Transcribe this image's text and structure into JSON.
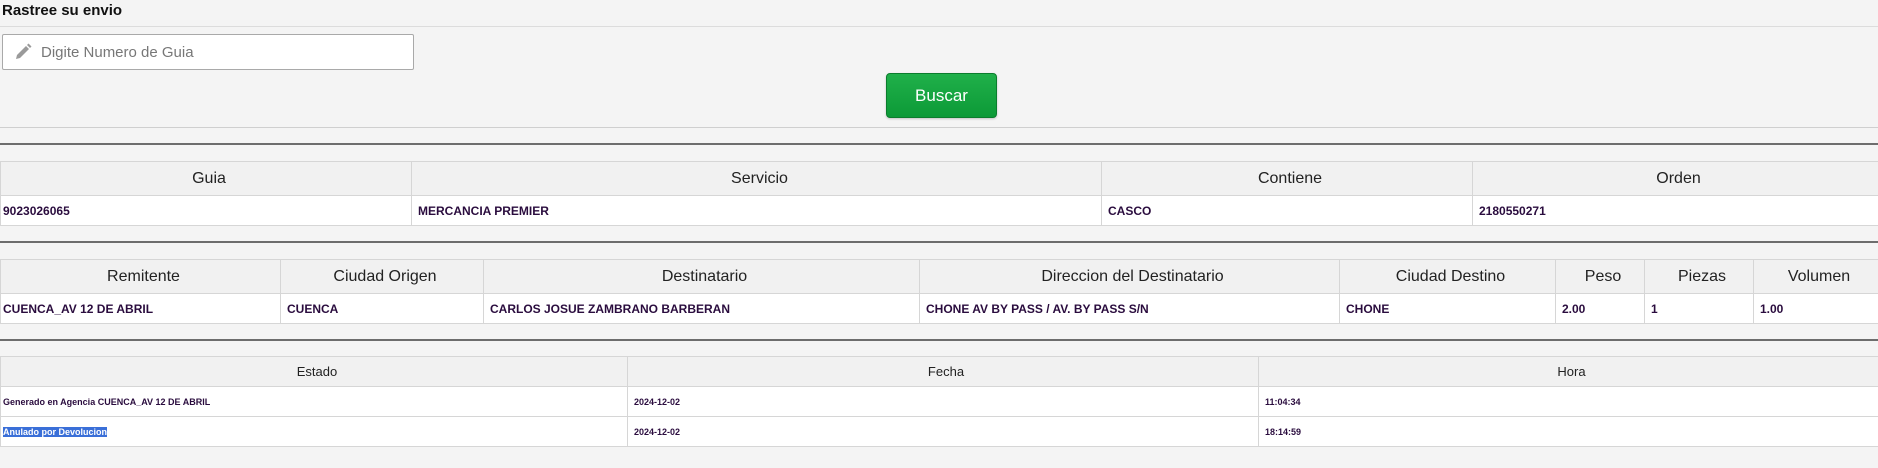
{
  "header": {
    "title": "Rastree su envio"
  },
  "search": {
    "placeholder": "Digite Numero de Guia",
    "value": "",
    "button_label": "Buscar"
  },
  "shipment": {
    "headers": [
      "Guia",
      "Servicio",
      "Contiene",
      "Orden"
    ],
    "row": [
      "9023026065",
      "MERCANCIA PREMIER",
      "CASCO",
      "2180550271"
    ]
  },
  "details": {
    "headers": [
      "Remitente",
      "Ciudad Origen",
      "Destinatario",
      "Direccion del Destinatario",
      "Ciudad Destino",
      "Peso",
      "Piezas",
      "Volumen"
    ],
    "row": [
      "CUENCA_AV 12 DE ABRIL",
      "CUENCA",
      "CARLOS JOSUE ZAMBRANO BARBERAN",
      "CHONE AV BY PASS / AV. BY PASS S/N",
      "CHONE",
      "2.00",
      "1",
      "1.00"
    ]
  },
  "tracking": {
    "headers": [
      "Estado",
      "Fecha",
      "Hora"
    ],
    "rows": [
      {
        "estado": "Generado en Agencia CUENCA_AV 12 DE ABRIL",
        "fecha": "2024-12-02",
        "hora": "11:04:34"
      },
      {
        "estado": "Anulado por Devolucion",
        "fecha": "2024-12-02",
        "hora": "18:14:59"
      }
    ]
  }
}
